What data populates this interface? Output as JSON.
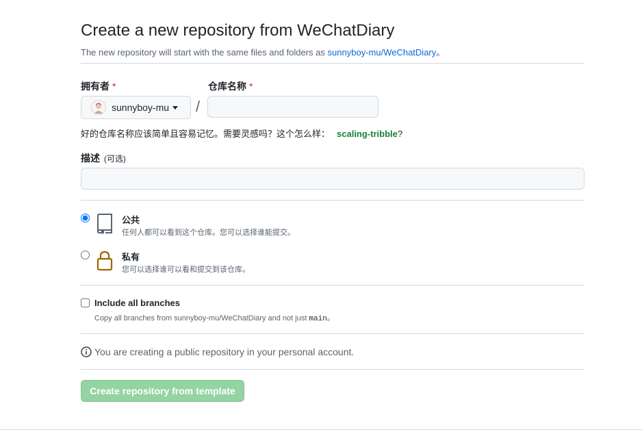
{
  "header": {
    "title": "Create a new repository from WeChatDiary",
    "subtitle_prefix": "The new repository will start with the same files and folders as ",
    "template_link": "sunnyboy-mu/WeChatDiary",
    "subtitle_suffix": "。"
  },
  "owner": {
    "label": "拥有者",
    "required_mark": "*",
    "value": "sunnyboy-mu"
  },
  "repo_name": {
    "label": "仓库名称",
    "required_mark": "*",
    "separator": "/",
    "value": "",
    "placeholder": ""
  },
  "name_hint": {
    "text": "好的仓库名称应该简单且容易记忆。需要灵感吗？这个怎么样：",
    "suggestion": "scaling-tribble",
    "suffix": "?"
  },
  "description": {
    "label": "描述",
    "optional": "(可选)",
    "value": ""
  },
  "visibility": {
    "public": {
      "title": "公共",
      "desc": "任何人都可以看到这个仓库。您可以选择谁能提交。",
      "checked": true
    },
    "private": {
      "title": "私有",
      "desc": "您可以选择谁可以看和提交到该仓库。",
      "checked": false
    }
  },
  "branches": {
    "label": "Include all branches",
    "desc_prefix": "Copy all branches from sunnyboy-mu/WeChatDiary and not just ",
    "desc_code": "main",
    "desc_suffix": "。",
    "checked": false
  },
  "info": {
    "icon": "info-icon",
    "text": "You are creating a public repository in your personal account."
  },
  "submit": {
    "label": "Create repository from template",
    "enabled": false
  },
  "colors": {
    "link": "#0969da",
    "suggestion": "#1a7f37",
    "required": "#d1242f",
    "submit_disabled": "#94d3a2",
    "lock_icon": "#9a6700"
  }
}
